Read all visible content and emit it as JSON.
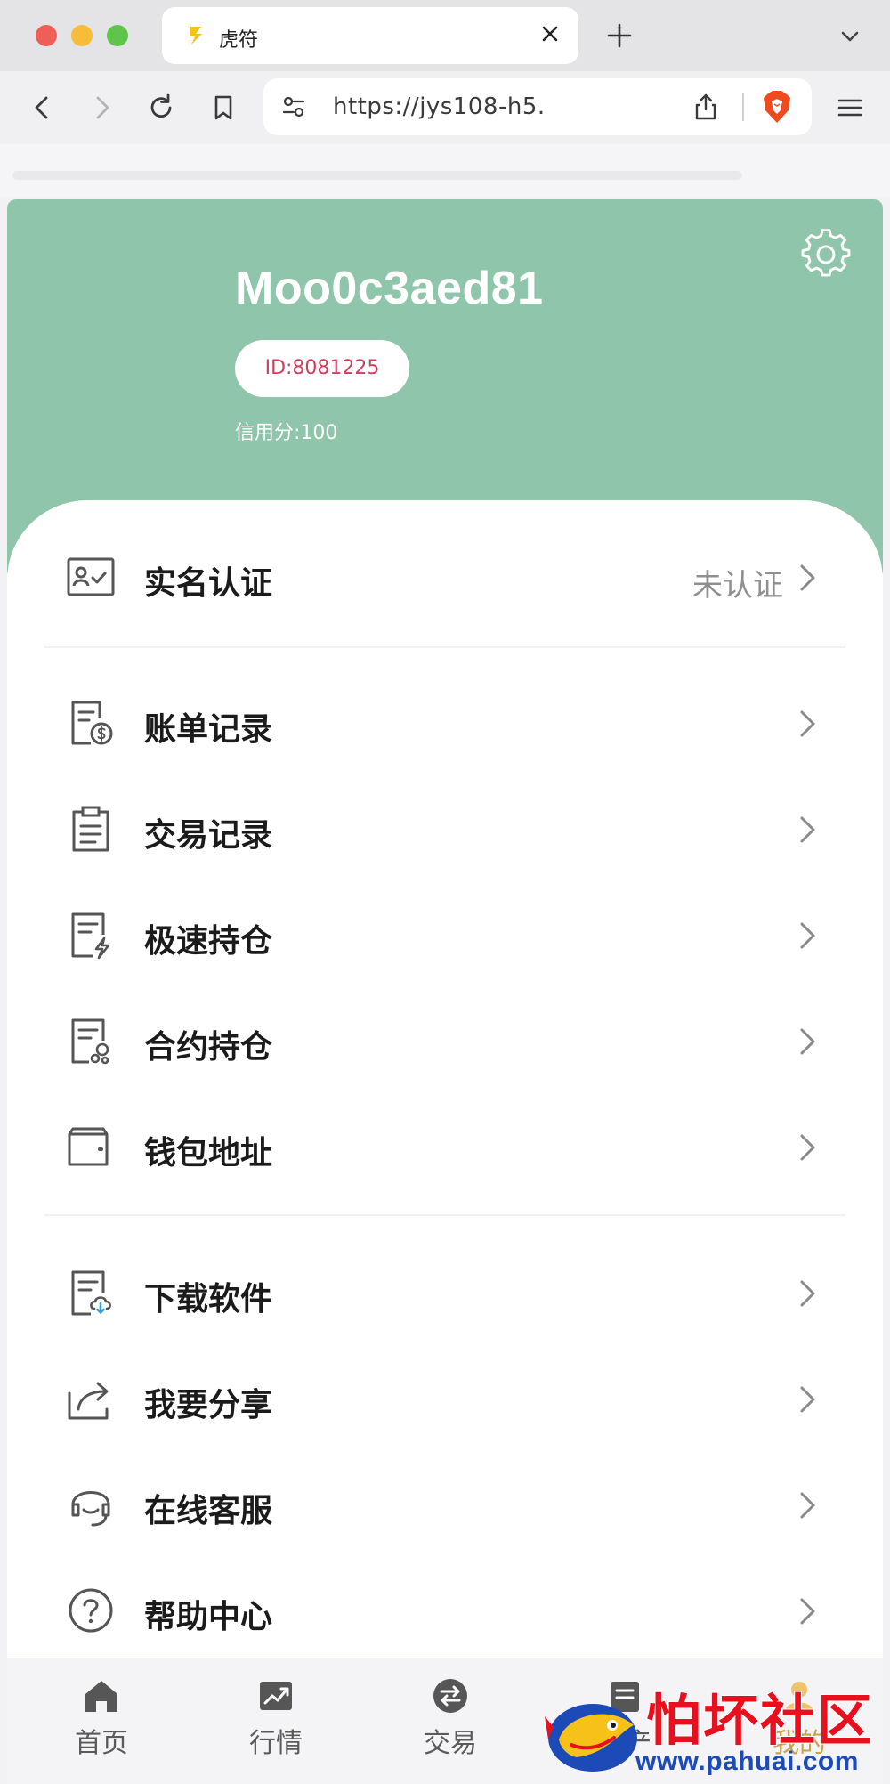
{
  "browser": {
    "tab_title": "虎符",
    "url": "https://jys108-h5."
  },
  "profile": {
    "username": "Moo0c3aed81",
    "id_label": "ID:8081225",
    "credit_label": "信用分:100"
  },
  "menu": {
    "verify": {
      "label": "实名认证",
      "status": "未认证",
      "icon": "id-card-icon"
    },
    "billing": {
      "label": "账单记录",
      "icon": "bill-icon"
    },
    "trades": {
      "label": "交易记录",
      "icon": "clipboard-icon"
    },
    "fast_positions": {
      "label": "极速持仓",
      "icon": "lightning-doc-icon"
    },
    "contract_positions": {
      "label": "合约持仓",
      "icon": "contract-doc-icon"
    },
    "wallet": {
      "label": "钱包地址",
      "icon": "wallet-icon"
    },
    "download": {
      "label": "下载软件",
      "icon": "cloud-download-doc-icon"
    },
    "share": {
      "label": "我要分享",
      "icon": "share-icon"
    },
    "support": {
      "label": "在线客服",
      "icon": "headset-icon"
    },
    "help": {
      "label": "帮助中心",
      "icon": "help-circle-icon"
    }
  },
  "bottom_nav": {
    "home": "首页",
    "market": "行情",
    "trade": "交易",
    "assets": "资产",
    "mine": "我的"
  },
  "watermark": {
    "cn": "怕坏社区",
    "url": "www.pahuai.com"
  },
  "colors": {
    "header_bg": "#8fc5aa",
    "id_text": "#d03e5e",
    "watermark_red": "#e8101e",
    "watermark_blue": "#1c4bb8"
  }
}
